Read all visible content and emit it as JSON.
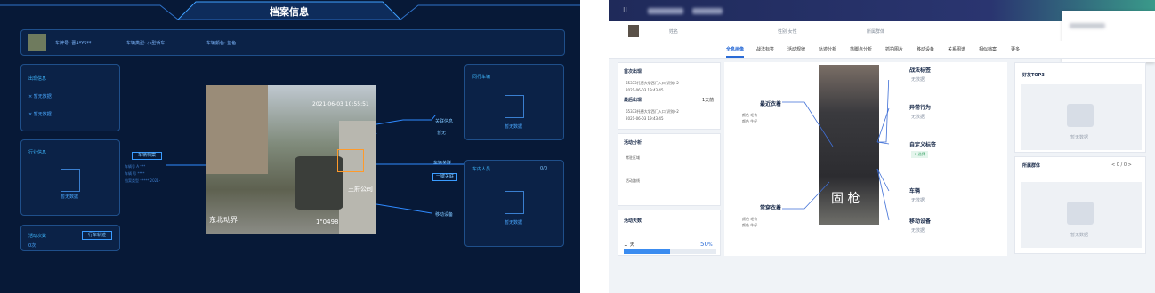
{
  "left": {
    "title": "档案信息",
    "vehicle": {
      "plate": "车牌号:  晋A*Y5**",
      "type": "车辆类型: 小型轿车",
      "color": "车辆颜色: 蓝色"
    },
    "appear": {
      "title": "出现信息",
      "items": [
        "× 暂无数据",
        "× 暂无数据"
      ]
    },
    "industry": {
      "title": "行业信息",
      "empty": "暂无数据"
    },
    "active": {
      "title": "活动次数",
      "unit": "次",
      "value": "0",
      "btn": "行车轨迹"
    },
    "record_label": "车辆档案",
    "info_lines": [
      "车辆号  A  ***",
      "车辆 号  ****",
      "档案类型 ***** 2021-"
    ],
    "right_tags": [
      "关联信息",
      "暂无",
      "车辆关联",
      "一键关联",
      "移动设备"
    ],
    "peer": {
      "title": "同行车辆",
      "empty": "暂无数据"
    },
    "people": {
      "title": "车内人员",
      "pager": "0/0",
      "empty": "暂无数据"
    },
    "cam_text": "2021-06-03 10:55:51",
    "cam_overlay": [
      "东北动界",
      "1\"0498",
      "王府公司"
    ]
  },
  "right": {
    "profile": {
      "name_lbl": "姓名",
      "gender_lbl": "性别",
      "gender": "女性",
      "group_lbl": "所属群体"
    },
    "tabs": [
      "全息画像",
      "战法标签",
      "活动规律",
      "轨迹分析",
      "落脚点分析",
      "抓拍图片",
      "移动设备",
      "关系图谱",
      "相似档案",
      "更多"
    ],
    "first": {
      "title": "首次出现",
      "place": "65333托德大学西门入口(识别)-2",
      "time": "2021-06-03 19:43:45"
    },
    "last": {
      "title": "最后出现",
      "days": "1天前",
      "place": "65333托德大学西门入口(识别)-2",
      "time": "2021-06-03 19:43:45"
    },
    "analysis": {
      "title": "活动分析",
      "regular": "常驻区域",
      "path": "活动路线"
    },
    "days": {
      "title": "活动天数",
      "value": "1",
      "unit": "天",
      "pct": "50",
      "pct_unit": "%",
      "fill": 0.5
    },
    "center_tags": {
      "recent": "最近衣着",
      "common": "常穿衣着",
      "war": "战法标签",
      "war_sub": "无数据",
      "abnormal": "异常行为",
      "abnormal_sub": "无数据",
      "custom": "自定义标签",
      "custom_btn": "+ 选择",
      "vehicle": "车辆",
      "vehicle_sub": "无数据",
      "device": "移动设备",
      "device_sub": "无数据"
    },
    "clothing": [
      [
        "颜色",
        "毛衣"
      ],
      [
        "颜色",
        "牛仔"
      ]
    ],
    "clothing2": [
      [
        "颜色",
        "毛衣"
      ],
      [
        "颜色",
        "牛仔"
      ]
    ],
    "photo_text": "固 枪",
    "friends": {
      "title": "好友TOP3",
      "empty": "暂无数据"
    },
    "groups": {
      "title": "所属群体",
      "pager": "< 0 / 0 >",
      "empty": "暂无数据"
    }
  }
}
